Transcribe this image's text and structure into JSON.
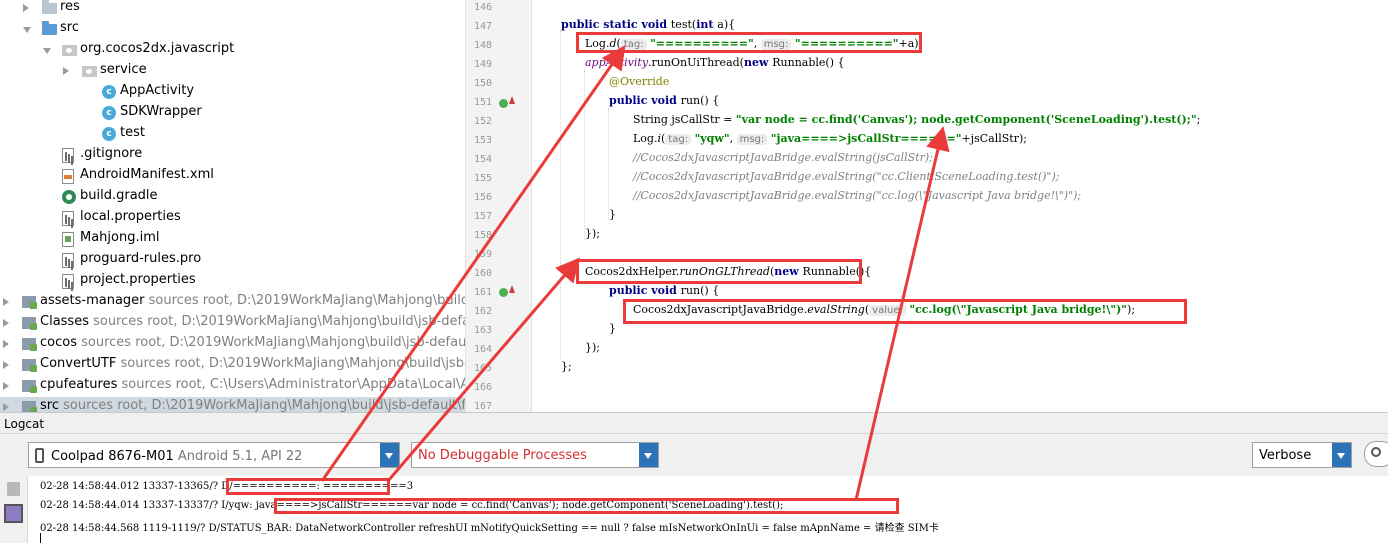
{
  "project_tree": {
    "items": [
      {
        "label": "res",
        "sub": ""
      },
      {
        "label": "src",
        "sub": ""
      },
      {
        "label": "org.cocos2dx.javascript",
        "sub": ""
      },
      {
        "label": "service",
        "sub": ""
      },
      {
        "label": "AppActivity",
        "sub": ""
      },
      {
        "label": "SDKWrapper",
        "sub": ""
      },
      {
        "label": "test",
        "sub": ""
      },
      {
        "label": ".gitignore",
        "sub": ""
      },
      {
        "label": "AndroidManifest.xml",
        "sub": ""
      },
      {
        "label": "build.gradle",
        "sub": ""
      },
      {
        "label": "local.properties",
        "sub": ""
      },
      {
        "label": "Mahjong.iml",
        "sub": ""
      },
      {
        "label": "proguard-rules.pro",
        "sub": ""
      },
      {
        "label": "project.properties",
        "sub": ""
      },
      {
        "label": "assets-manager",
        "sub": "sources root,  D:\\2019WorkMaJiang\\Mahjong\\build\\js"
      },
      {
        "label": "Classes",
        "sub": "sources root,  D:\\2019WorkMaJiang\\Mahjong\\build\\jsb-defau"
      },
      {
        "label": "cocos",
        "sub": "sources root,  D:\\2019WorkMaJiang\\Mahjong\\build\\jsb-default"
      },
      {
        "label": "ConvertUTF",
        "sub": "sources root,  D:\\2019WorkMaJiang\\Mahjong\\build\\jsb-d"
      },
      {
        "label": "cpufeatures",
        "sub": "sources root,  C:\\Users\\Administrator\\AppData\\Local\\An"
      },
      {
        "label": "src",
        "sub": "sources root,  D:\\2019WorkMaJiang\\Mahjong\\build\\jsb-default\\fr"
      }
    ],
    "class_badge": "c"
  },
  "editor": {
    "line_numbers": [
      "146",
      "147",
      "148",
      "149",
      "150",
      "151",
      "152",
      "153",
      "154",
      "155",
      "156",
      "157",
      "158",
      "159",
      "160",
      "161",
      "162",
      "163",
      "164",
      "165",
      "166",
      "167"
    ],
    "code": {
      "l147_kw": "public static void ",
      "l147_rest": "test(",
      "l147_kw2": "int ",
      "l147_end": "a){",
      "l148_log": "Log.",
      "l148_mth": "d",
      "l148_open": "(",
      "l148_hint1": "tag:",
      "l148_str1": "\"==========\"",
      "l148_comma": ", ",
      "l148_hint2": "msg:",
      "l148_str2": "\"==========\"",
      "l148_end": "+a);",
      "l149_fld": "appActivity",
      "l149_dot": ".runOnUiThread(",
      "l149_kw": "new ",
      "l149_end": "Runnable() {",
      "l150_ann": "@Override",
      "l151_kw": "public void ",
      "l151_end": "run() {",
      "l152_pre": "String jsCallStr = ",
      "l152_str": "\"var node = cc.find('Canvas'); node.getComponent('SceneLoading').test();\"",
      "l152_end": ";",
      "l153_log": "Log.",
      "l153_mth": "i",
      "l153_open": "(",
      "l153_hint1": "tag:",
      "l153_str1": "\"yqw\"",
      "l153_comma": ", ",
      "l153_hint2": "msg:",
      "l153_str2": "\"java====>jsCallStr======\"",
      "l153_end": "+jsCallStr);",
      "l154_cmt": "//Cocos2dxJavascriptJavaBridge.evalString(jsCallStr);",
      "l155_cmt": "//Cocos2dxJavascriptJavaBridge.evalString(\"cc.Client.SceneLoading.test()\");",
      "l156_cmt": "//Cocos2dxJavascriptJavaBridge.evalString(\"cc.log(\\\"Javascript Java bridge!\\\")\");",
      "l157": "}",
      "l158": "});",
      "l160_pre": "Cocos2dxHelper.",
      "l160_mth": "runOnGLThread",
      "l160_open": "(",
      "l160_kw": "new ",
      "l160_end": "Runnable(){",
      "l161_kw": "public void ",
      "l161_end": "run() {",
      "l162_pre": "Cocos2dxJavascriptJavaBridge.",
      "l162_mth": "evalString",
      "l162_open": "(",
      "l162_hint": "value:",
      "l162_str": "\"cc.log(\\\"Javascript Java bridge!\\\")\"",
      "l162_end": ");",
      "l163": "}",
      "l164": "});",
      "l165": "};"
    }
  },
  "logcat": {
    "tab_label": "Logcat",
    "device": {
      "name": "Coolpad 8676-M01",
      "detail": "Android 5.1, API 22"
    },
    "process": "No Debuggable Processes",
    "level": "Verbose",
    "lines": [
      {
        "prefix": "02-28 14:58:44.012 13337-13365/? ",
        "msg": "D/==========: ==========3"
      },
      {
        "prefix": "02-28 14:58:44.014 13337-13337/? I/yqw: ",
        "msg": "java====>jsCallStr======var node = cc.find('Canvas'); node.getComponent('SceneLoading').test();"
      },
      {
        "prefix": "02-28 14:58:44.568 1119-1119/? ",
        "msg": "D/STATUS_BAR: DataNetworkController refreshUI mNotifyQuickSetting == null ? false mIsNetworkOnInUi = false mApnName = 请检查 SIM卡"
      }
    ]
  },
  "colors": {
    "annotation": "#ea3a3a",
    "keyword": "#000080",
    "string": "#008000",
    "accent": "#2c73b8"
  },
  "icons": [
    "chevron-right-icon",
    "chevron-down-icon",
    "folder-icon",
    "package-icon",
    "class-icon",
    "file-icon",
    "gradle-icon",
    "module-icon",
    "phone-icon",
    "search-icon",
    "trash-icon",
    "scroll-to-end-icon",
    "override-marker-icon"
  ]
}
